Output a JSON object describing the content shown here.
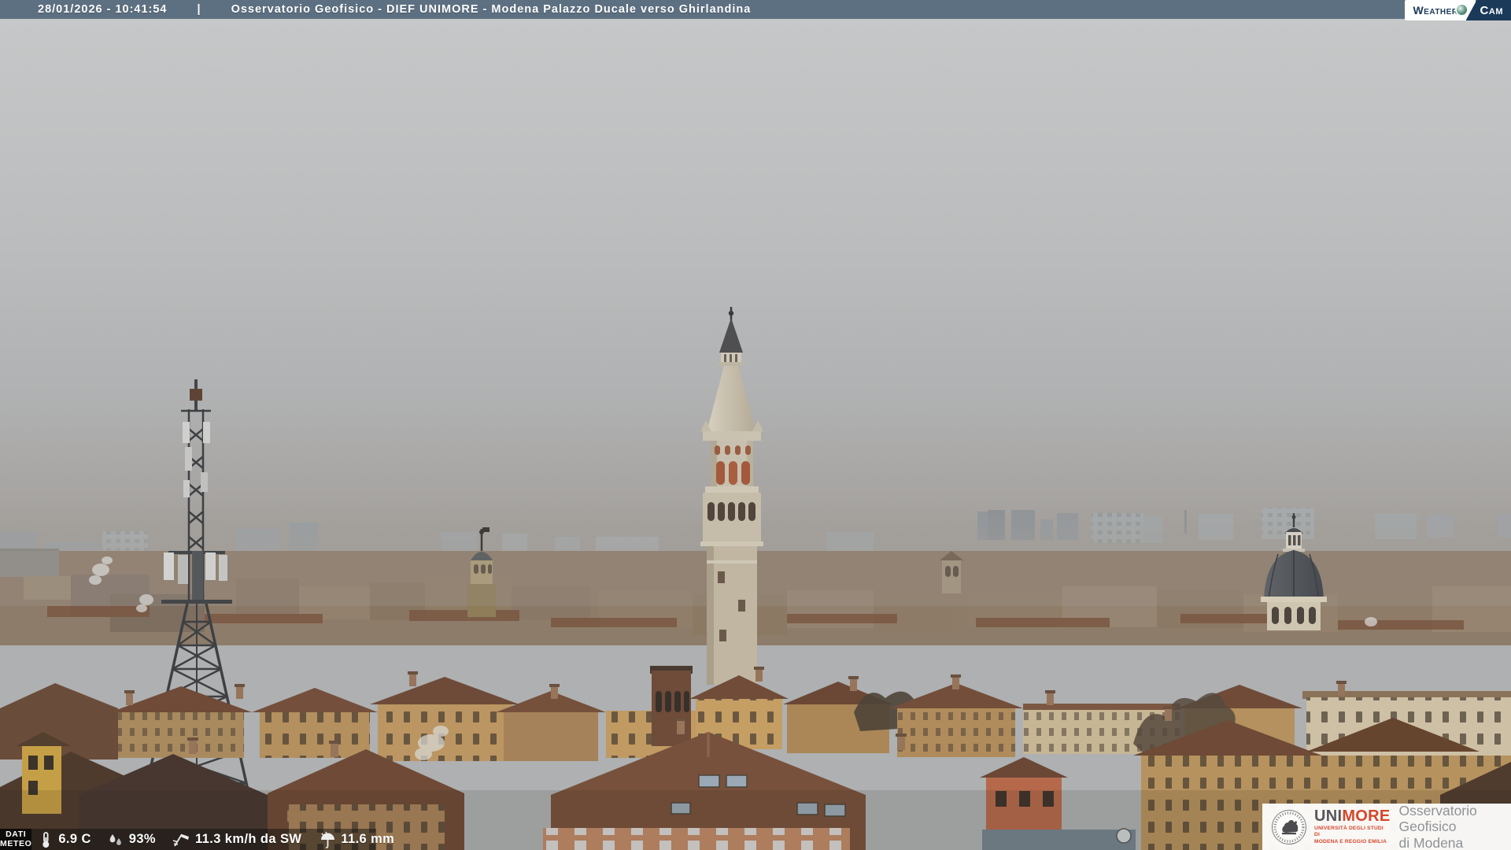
{
  "header": {
    "datetime": "28/01/2026 - 10:41:54",
    "separator": "|",
    "title": "Osservatorio Geofisico - DIEF UNIMORE - Modena Palazzo Ducale verso Ghirlandina",
    "logo": {
      "weather": "Weather",
      "cam": "Cam"
    }
  },
  "weather_bar": {
    "label_line1": "DATI",
    "label_line2": "METEO",
    "temperature": "6.9 C",
    "humidity": "93%",
    "wind": "11.3 km/h da SW",
    "rain": "11.6 mm",
    "icons": [
      "thermometer-icon",
      "humidity-drops-icon",
      "windsock-icon",
      "rain-umbrella-icon"
    ]
  },
  "footer_logo": {
    "uni": "UNI",
    "more": "MORE",
    "subtitle_line1": "UNIVERSITÀ DEGLI STUDI DI",
    "subtitle_line2": "MODENA E REGGIO EMILIA",
    "org_line1": "Osservatorio Geofisico",
    "org_line2": "di Modena"
  },
  "scene": {
    "colors": {
      "topbar": "#5d7082",
      "sky_top": "#c6c8c9",
      "sky_horizon": "#a09c98",
      "tower_stone": "#c8c0ae",
      "roof_terracotta": "#77513c",
      "facade_ochre": "#b6905c",
      "unimore_red": "#d5472c",
      "logo_navy": "#1b3a5a"
    }
  }
}
